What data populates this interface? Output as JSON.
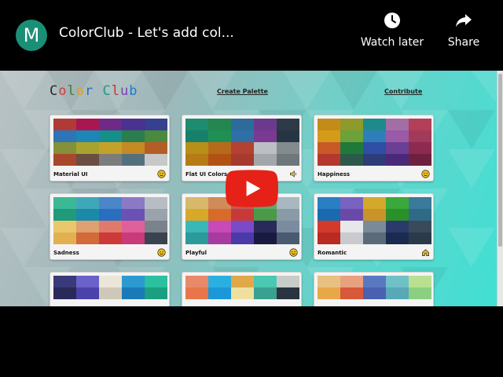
{
  "video": {
    "channel_initial": "M",
    "title": "ColorClub - Let's add col...",
    "watch_later_label": "Watch later",
    "share_label": "Share"
  },
  "site": {
    "logo_letters": [
      "C",
      "o",
      "l",
      "o",
      "r",
      " ",
      "C",
      "l",
      "u",
      "b"
    ],
    "logo_colors": [
      "#2a2a2a",
      "#d83b3b",
      "#3a7d3a",
      "#e2a21b",
      "#2b6cc4",
      "#000",
      "#1f9a8a",
      "#c0392b",
      "#7a3fb0",
      "#1c7ad6"
    ],
    "nav_create": "Create Palette",
    "nav_contribute": "Contribute"
  },
  "palettes": [
    {
      "name": "Material UI",
      "icon": "emoji-face-icon",
      "colors": [
        "#b23a36",
        "#a8174f",
        "#6e2a86",
        "#4a3290",
        "#35408f",
        "#2e74b6",
        "#1e86b7",
        "#158f8a",
        "#2a7d4f",
        "#4a8a3e",
        "#85903a",
        "#a6a42e",
        "#c4a22a",
        "#c48a24",
        "#b45e27",
        "#a8472b",
        "#6a4e42",
        "#7c7c7c",
        "#55707d",
        "#c8c8c8"
      ]
    },
    {
      "name": "Flat UI Colors",
      "icon": "speaker-icon",
      "colors": [
        "#1e8c6e",
        "#23874f",
        "#2c6b9a",
        "#6b3a8c",
        "#2e3a48",
        "#17806b",
        "#1f8f54",
        "#2d6fa6",
        "#7a3a92",
        "#263544",
        "#b88f18",
        "#b86a1c",
        "#b44132",
        "#bcbfc3",
        "#838b8f",
        "#b57b16",
        "#b15214",
        "#a53a2d",
        "#a3a7aa",
        "#6e777b"
      ]
    },
    {
      "name": "Happiness",
      "icon": "emoji-face-icon",
      "colors": [
        "#c38c19",
        "#8e9a2c",
        "#1f8a8a",
        "#a36da6",
        "#b43f58",
        "#d49a1a",
        "#6da13a",
        "#2e7fb9",
        "#9a5aa8",
        "#a23a5c",
        "#c85a28",
        "#1f7a3a",
        "#2f4ea6",
        "#6a3f96",
        "#8c2a50",
        "#b5382f",
        "#2b5a4a",
        "#2c3d78",
        "#4a2a78",
        "#6d2040"
      ]
    },
    {
      "name": "Sadness",
      "icon": "emoji-face-icon",
      "colors": [
        "#3bb895",
        "#3fa8b8",
        "#4a86c8",
        "#8a7ac6",
        "#b8bcc4",
        "#1f9a7a",
        "#1b8aa8",
        "#2a6ec0",
        "#6a52b4",
        "#9aa2ac",
        "#e8c86a",
        "#e0a070",
        "#e07a6a",
        "#e0609a",
        "#7a828c",
        "#e2b050",
        "#d26a3a",
        "#cc3a3a",
        "#c83a7a",
        "#3a4450"
      ]
    },
    {
      "name": "Playful",
      "icon": "emoji-face-icon",
      "colors": [
        "#d8b86a",
        "#cf8c5a",
        "#c45a5a",
        "#5fa86a",
        "#a8b8c0",
        "#d8a828",
        "#d86a2a",
        "#c83a3a",
        "#4a9a4a",
        "#8a9aa6",
        "#3ab8b8",
        "#c84ab8",
        "#7a4ac8",
        "#2a2a5a",
        "#7a8ca0",
        "#2a9a9a",
        "#a83aa0",
        "#4a3aa8",
        "#1a1a40",
        "#4a5a70"
      ]
    },
    {
      "name": "Romantic",
      "icon": "home-icon",
      "colors": [
        "#2a7fc4",
        "#7a62c0",
        "#d4a82a",
        "#3aa83a",
        "#3a7a9a",
        "#1a6ab0",
        "#6a4aa8",
        "#c8942a",
        "#2a902a",
        "#2e6a86",
        "#d43a2a",
        "#e8e8ea",
        "#7a8a98",
        "#2a3a6a",
        "#3a4a5a",
        "#b82a22",
        "#c8cad0",
        "#5a6a78",
        "#1a2a50",
        "#2a3a48"
      ]
    },
    {
      "name": "",
      "icon": "",
      "colors": [
        "#3a3a7a",
        "#6a62c8",
        "#ece6d8",
        "#2a9ad0",
        "#2ac0a0",
        "#2a2a5a",
        "#4a42a8",
        "#cfc8b8",
        "#1a7ab8",
        "#1aa080"
      ]
    },
    {
      "name": "",
      "icon": "",
      "colors": [
        "#e88a6a",
        "#2ab0e0",
        "#e0a848",
        "#4ac8b0",
        "#c8ccc8",
        "#e8764a",
        "#1a98d8",
        "#f0e0a0",
        "#3aa090",
        "#2a3440"
      ]
    },
    {
      "name": "",
      "icon": "",
      "colors": [
        "#e8c080",
        "#e8a080",
        "#5a78c0",
        "#70c0c8",
        "#b8e090",
        "#e8a848",
        "#d8583a",
        "#4a60b0",
        "#58a8b8",
        "#8ad080"
      ]
    }
  ]
}
